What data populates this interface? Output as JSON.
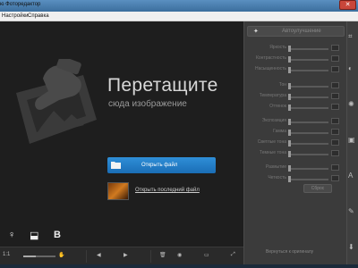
{
  "window": {
    "title": "ю Фоторедактор",
    "close_label": "✕"
  },
  "menu": {
    "items": [
      "Настройки",
      "Справка"
    ]
  },
  "dropzone": {
    "title": "Перетащите",
    "subtitle": "сюда изображение"
  },
  "actions": {
    "open_file": "Открыть файл",
    "open_recent": "Открыть последний файл"
  },
  "tools": [
    "♀",
    "⬓",
    "B"
  ],
  "bottombar": {
    "zoom_label": "1:1",
    "zoom_level": 0.4
  },
  "panel": {
    "header_label": "Автоулучшение",
    "sliders": [
      "Яркость",
      "Контрастность",
      "Насыщенность",
      "Тон",
      "Температура",
      "Оттенок",
      "Экспозиция",
      "Гамма",
      "Светлые тона",
      "Темные тона",
      "Размытие",
      "Четкость"
    ],
    "reset_label": "Сброс",
    "return_label": "Вернуться к оригиналу"
  }
}
